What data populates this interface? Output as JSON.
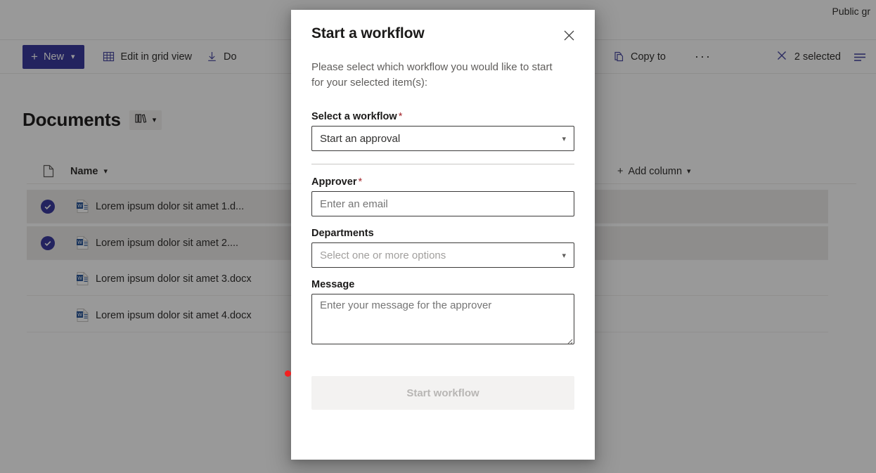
{
  "topbar": {
    "right_label": "Public gr"
  },
  "commandbar": {
    "new_label": "New",
    "new_icon": "plus-icon",
    "new_chevron": "chevron-down-icon",
    "items": [
      {
        "label": "Edit in grid view",
        "icon": "grid-icon"
      },
      {
        "label": "Do",
        "icon": "download-icon"
      },
      {
        "label": "Copy to",
        "icon": "copy-icon"
      },
      {
        "label": "···",
        "icon": "more-icon"
      }
    ],
    "selected_label": "2 selected",
    "selected_icon": "close-icon",
    "view_options_icon": "list-options-icon"
  },
  "documents": {
    "title": "Documents",
    "view_icon": "library-icon",
    "view_chevron": "chevron-down-icon"
  },
  "list": {
    "columns": {
      "type_icon": "document-icon",
      "name": "Name",
      "name_chevron": "chevron-down-icon",
      "add_column": "Add column",
      "add_column_icon": "plus-icon",
      "add_column_chevron": "chevron-down-icon"
    },
    "rows": [
      {
        "name": "Lorem ipsum dolor sit amet 1.d...",
        "selected": true,
        "icon": "word-file-icon"
      },
      {
        "name": "Lorem ipsum dolor sit amet 2....",
        "selected": true,
        "icon": "word-file-icon"
      },
      {
        "name": "Lorem ipsum dolor sit amet 3.docx",
        "selected": false,
        "icon": "word-file-icon"
      },
      {
        "name": "Lorem ipsum dolor sit amet 4.docx",
        "selected": false,
        "icon": "word-file-icon"
      }
    ]
  },
  "dialog": {
    "title": "Start a workflow",
    "close_icon": "close-icon",
    "subtitle": "Please select which workflow you would like to start for your selected item(s):",
    "workflow": {
      "label": "Select a workflow",
      "required_mark": "*",
      "value": "Start an approval",
      "chevron": "chevron-down-icon"
    },
    "approver": {
      "label": "Approver",
      "required_mark": "*",
      "value": "",
      "placeholder": "Enter an email"
    },
    "departments": {
      "label": "Departments",
      "value": "",
      "placeholder": "Select one or more options",
      "chevron": "chevron-down-icon"
    },
    "message": {
      "label": "Message",
      "value": "",
      "placeholder": "Enter your message for the approver"
    },
    "submit_label": "Start workflow",
    "submit_disabled": true
  },
  "colors": {
    "accent": "#3b3b9e",
    "required": "#a4262c",
    "cursor_dot": "#f32020",
    "overlay": "rgba(0,0,0,0.40)"
  }
}
